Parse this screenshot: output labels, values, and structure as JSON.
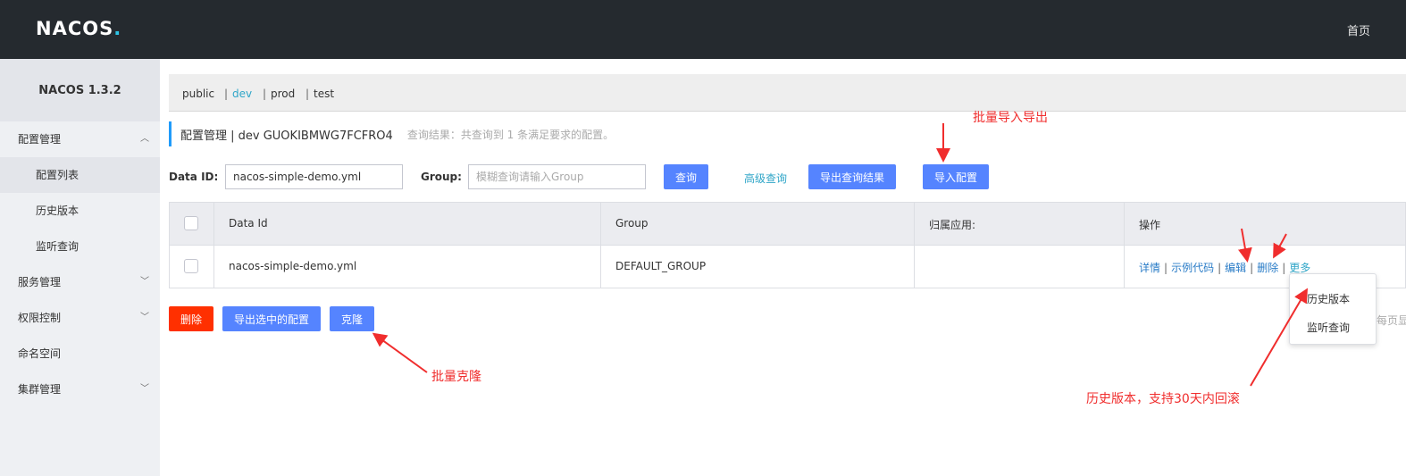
{
  "header": {
    "logo_text": "NACOS",
    "logo_dot": ".",
    "home": "首页"
  },
  "sidebar": {
    "title": "NACOS 1.3.2",
    "items": [
      {
        "label": "配置管理",
        "chevron": "︿"
      },
      {
        "label": "配置列表"
      },
      {
        "label": "历史版本"
      },
      {
        "label": "监听查询"
      },
      {
        "label": "服务管理",
        "chevron": "﹀"
      },
      {
        "label": "权限控制",
        "chevron": "﹀"
      },
      {
        "label": "命名空间"
      },
      {
        "label": "集群管理",
        "chevron": "﹀"
      }
    ]
  },
  "namespaces": {
    "items": [
      "public",
      "dev",
      "prod",
      "test"
    ],
    "active": "dev",
    "separator": "|"
  },
  "title": {
    "text": "配置管理 | dev GUOKIBMWG7FCFRO4",
    "hint": "查询结果：共查询到 1 条满足要求的配置。"
  },
  "search": {
    "dataid_label": "Data ID:",
    "dataid_value": "nacos-simple-demo.yml",
    "group_label": "Group:",
    "group_placeholder": "模糊查询请输入Group",
    "query_button": "查询",
    "advanced_link": "高级查询",
    "export_query_button": "导出查询结果",
    "import_button": "导入配置"
  },
  "table": {
    "headers": [
      "Data Id",
      "Group",
      "归属应用:",
      "操作"
    ],
    "rows": [
      {
        "data_id": "nacos-simple-demo.yml",
        "group": "DEFAULT_GROUP",
        "app": ""
      }
    ],
    "ops": {
      "detail": "详情",
      "sample": "示例代码",
      "edit": "编辑",
      "delete": "删除",
      "more": "更多",
      "sep": "|"
    }
  },
  "dropdown": {
    "items": [
      "历史版本",
      "监听查询"
    ]
  },
  "bottom": {
    "delete": "删除",
    "export_selected": "导出选中的配置",
    "clone": "克隆",
    "clipped_text": "每页显"
  },
  "annotations": {
    "batch_import_export": "批量导入导出",
    "batch_clone": "批量克隆",
    "history_rollback": "历史版本，支持30天内回滚"
  },
  "colors": {
    "header_bg": "#252a2f",
    "primary": "#5584ff",
    "danger": "#ff3000",
    "annotation": "#f02d2d",
    "link": "#30a6c8"
  }
}
